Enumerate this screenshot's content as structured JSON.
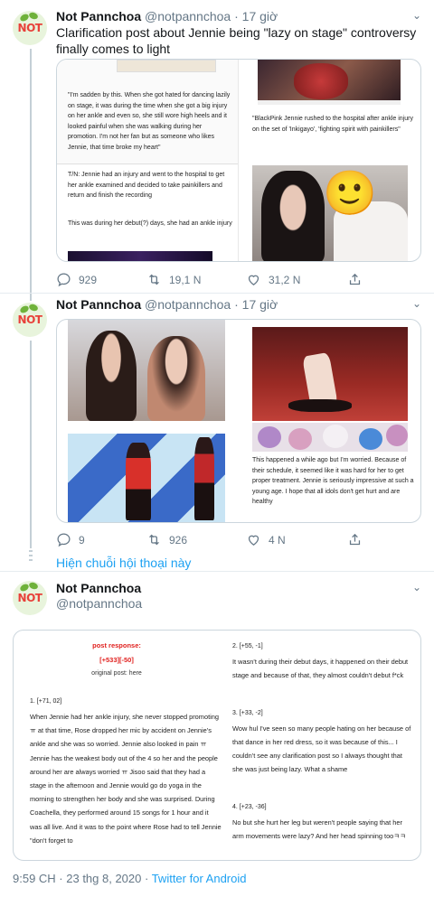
{
  "tweet1": {
    "author_name": "Not Pannchoa",
    "handle": "@notpannchoa",
    "separator": "·",
    "time": "17 giờ",
    "text": "Clarification post about Jennie being \"lazy on stage\" controversy finally comes to light",
    "media": {
      "quote_left": "\"I'm sadden by this. When she got hated for dancing lazily on stage, it was during the time when she got a big injury on her ankle and even so, she still wore high heels and it looked painful when she was walking during her promotion. I'm not her fan but as someone who likes Jennie, that time broke my heart\"",
      "tn_note": "T/N: Jennie had an injury and went to the hospital to get her ankle examined and decided to take painkillers and return and finish the recording",
      "debut_note": "This was during her debut(?) days, she had an ankle injury",
      "news_caption": "\"BlackPink Jennie rushed to the hospital after ankle injury on the set of 'Inkigayo', 'fighting spirit with painkillers\"",
      "emoji": "🙂"
    },
    "replies": "929",
    "retweets": "19,1 N",
    "likes": "31,2 N"
  },
  "tweet2": {
    "author_name": "Not Pannchoa",
    "handle": "@notpannchoa",
    "separator": "·",
    "time": "17 giờ",
    "media": {
      "caption": "This happened a while ago but I'm worried. Because of their schedule, it seemed like it was hard for her to get proper treatment. Jennie is seriously impressive at such a young age. I hope that all idols don't get hurt and are healthy"
    },
    "replies": "9",
    "retweets": "926",
    "likes": "4 N",
    "show_thread": "Hiện chuỗi hội thoại này"
  },
  "tweet3": {
    "author_name": "Not Pannchoa",
    "handle": "@notpannchoa",
    "media": {
      "post_response": "post response:",
      "score": "[+533][-50]",
      "original_post": "original post: here",
      "c1_head": "1. [+71, 02]",
      "c1_body": "When Jennie had her ankle injury, she never stopped promoting ㅠ at that time, Rose dropped her mic by accident on Jennie's ankle and she was so worried. Jennie also looked in pain ㅠ Jennie has the weakest body out of the 4 so her and the people around her are always worried ㅠ Jisoo said that they had a stage in the afternoon and Jennie would go do yoga in the morning to strengthen her body and she was surprised. During Coachella, they performed around 15 songs for 1 hour and it was all live. And it was to the point where Rose had to tell Jennie \"don't forget to",
      "c2_head": "2. [+55, -1]",
      "c2_body": "It wasn't during their debut days, it happened on their debut stage and because of that, they almost couldn't debut f*ck",
      "c3_head": "3. [+33, -2]",
      "c3_body": "Wow hul I've seen so many people hating on her because of that dance in her red dress, so it was because of this... I couldn't see any clarification post so I always thought that she was just being lazy. What a shame",
      "c4_head": "4. [+23, -36]",
      "c4_body": "No but she hurt her leg but weren't people saying that her arm movements were lazy? And her head spinning tooㅋㅋ"
    },
    "timestamp": "9:59 CH · 23 thg 8, 2020 · ",
    "source": "Twitter for Android"
  },
  "colors": {
    "accent": "#1da1f2",
    "secondary_text": "#657786",
    "red": "#e0201e",
    "link": "#5a4bd1"
  },
  "icons": [
    "reply-icon",
    "retweet-icon",
    "like-icon",
    "share-icon",
    "chevron-down-icon"
  ]
}
